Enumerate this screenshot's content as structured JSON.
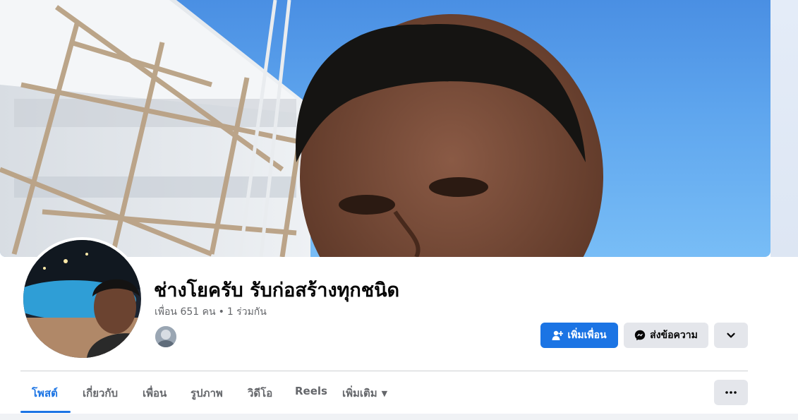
{
  "profile": {
    "name": "ช่างโยครับ รับก่อสร้างทุกชนิด",
    "friends_text": "เพื่อน 651 คน",
    "mutual_text": "1 ร่วมกัน"
  },
  "actions": {
    "add_friend_label": "เพิ่มเพื่อน",
    "message_label": "ส่งข้อความ"
  },
  "tabs": [
    {
      "label": "โพสต์",
      "active": true
    },
    {
      "label": "เกี่ยวกับ",
      "active": false
    },
    {
      "label": "เพื่อน",
      "active": false
    },
    {
      "label": "รูปภาพ",
      "active": false
    },
    {
      "label": "วิดีโอ",
      "active": false
    },
    {
      "label": "Reels",
      "active": false
    },
    {
      "label": "เพิ่มเติม",
      "active": false
    }
  ],
  "icons": {
    "add_friend": "person-plus-icon",
    "message": "messenger-icon",
    "more": "chevron-down-icon",
    "tab_more": "ellipsis-icon",
    "tab_caret": "caret-down-icon"
  },
  "colors": {
    "primary": "#1b74e4",
    "secondary_button": "#e4e6eb",
    "text_secondary": "#65676b"
  }
}
